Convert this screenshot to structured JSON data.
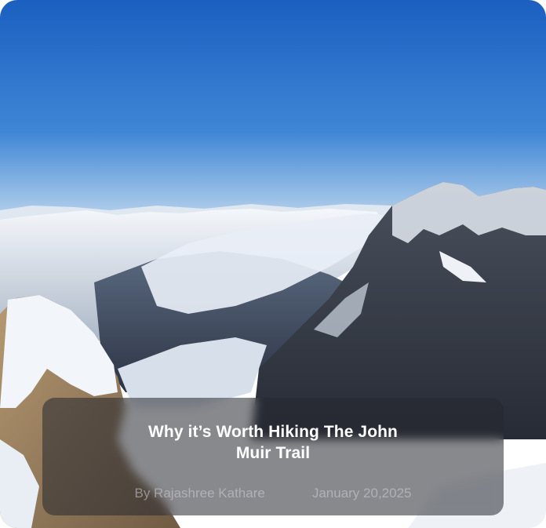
{
  "article": {
    "image_icon": "mountain-landscape-photo",
    "title": "Why it’s Worth Hiking The John Muir Trail",
    "author": "By Rajashree Kathare",
    "date": "January 20,2025"
  },
  "colors": {
    "sky_top": "#1f64c3",
    "sky_bottom": "#a9c8e6",
    "snow": "#eef2f7",
    "rock": "#3b4250",
    "overlay": "#262830"
  }
}
